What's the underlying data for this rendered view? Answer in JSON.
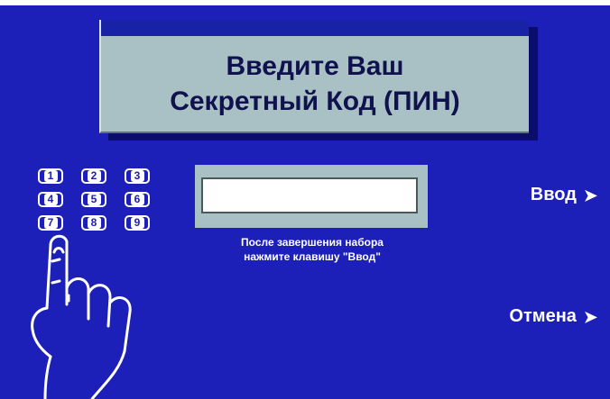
{
  "title": {
    "line1": "Введите Ваш",
    "line2": "Секретный Код (ПИН)"
  },
  "keypad": {
    "keys": [
      "1",
      "2",
      "3",
      "4",
      "5",
      "6",
      "7",
      "8",
      "9"
    ]
  },
  "pin_input": {
    "value": ""
  },
  "hint": {
    "line1": "После завершения набора",
    "line2": "нажмите клавишу \"Ввод\""
  },
  "buttons": {
    "enter_label": "Ввод",
    "cancel_label": "Отмена",
    "arrow_glyph": "➤"
  },
  "icons": {
    "hand": "pointing-hand-icon",
    "arrow": "arrow-right-icon"
  },
  "colors": {
    "background": "#1c20b8",
    "panel": "#a9c1c4",
    "title_text": "#10124e",
    "text": "#ffffff"
  }
}
